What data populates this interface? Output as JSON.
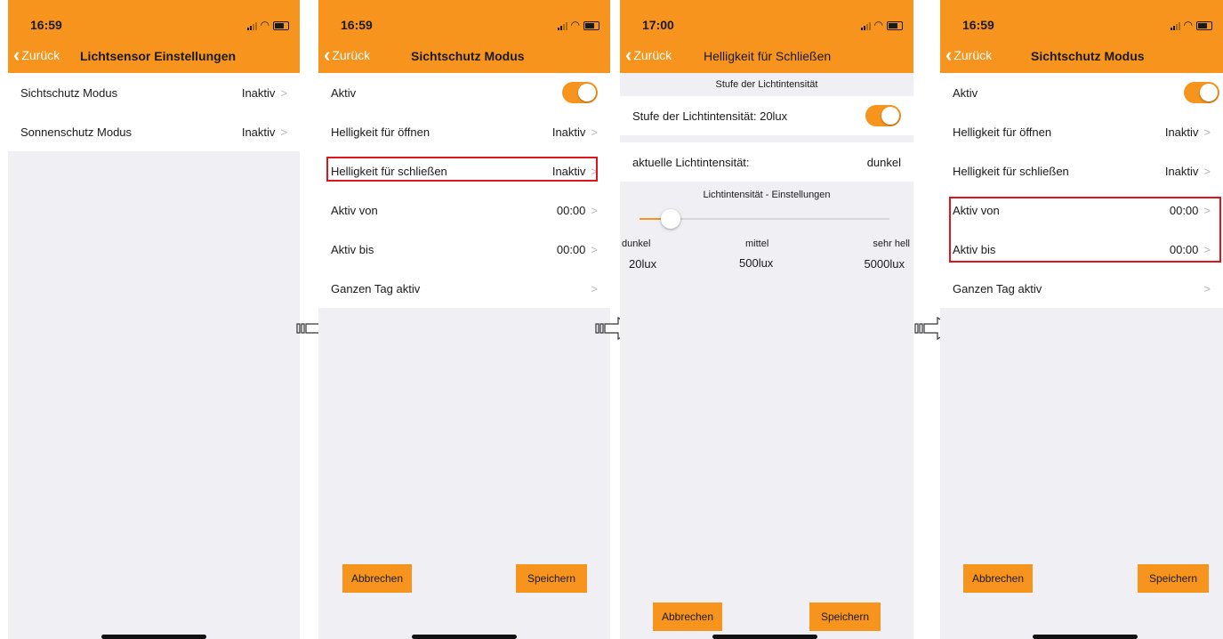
{
  "screen1": {
    "time": "16:59",
    "back_label": "Zurück",
    "title": "Lichtsensor Einstellungen",
    "rows": [
      {
        "label": "Sichtschutz Modus",
        "value": "Inaktiv"
      },
      {
        "label": "Sonnenschutz Modus",
        "value": "Inaktiv"
      }
    ]
  },
  "screen2": {
    "time": "16:59",
    "back_label": "Zurück",
    "title": "Sichtschutz Modus",
    "rows": [
      {
        "label": "Aktiv",
        "value": ""
      },
      {
        "label": "Helligkeit für öffnen",
        "value": "Inaktiv"
      },
      {
        "label": "Helligkeit für schließen",
        "value": "Inaktiv"
      },
      {
        "label": "Aktiv von",
        "value": "00:00"
      },
      {
        "label": "Aktiv bis",
        "value": "00:00"
      },
      {
        "label": "Ganzen Tag aktiv",
        "value": ""
      }
    ],
    "cancel_label": "Abbrechen",
    "save_label": "Speichern"
  },
  "screen3": {
    "time": "17:00",
    "back_label": "Zurück",
    "title": "Helligkeit für Schließen",
    "section1_header": "Stufe der Lichtintensität",
    "level_row": "Stufe der Lichtintensität: 20lux",
    "current_label": "aktuelle Lichtintensität:",
    "current_value": "dunkel",
    "section2_header": "Lichtintensität - Einstellungen",
    "levels": [
      "dunkel",
      "mittel",
      "sehr hell"
    ],
    "lux": [
      "20lux",
      "500lux",
      "5000lux"
    ],
    "cancel_label": "Abbrechen",
    "save_label": "Speichern"
  },
  "screen4": {
    "time": "16:59",
    "back_label": "Zurück",
    "title": "Sichtschutz Modus",
    "rows": [
      {
        "label": "Aktiv",
        "value": ""
      },
      {
        "label": "Helligkeit für öffnen",
        "value": "Inaktiv"
      },
      {
        "label": "Helligkeit für schließen",
        "value": "Inaktiv"
      },
      {
        "label": "Aktiv von",
        "value": "00:00"
      },
      {
        "label": "Aktiv bis",
        "value": "00:00"
      },
      {
        "label": "Ganzen Tag aktiv",
        "value": ""
      }
    ],
    "cancel_label": "Abbrechen",
    "save_label": "Speichern"
  },
  "colors": {
    "accent": "#f7941d",
    "highlight": "#e0151b",
    "background": "#efeff4"
  },
  "icons": [
    "back-chevron-icon",
    "signal-icon",
    "wifi-icon",
    "battery-icon",
    "chevron-right-icon",
    "toggle-switch",
    "next-step-arrow-icon"
  ]
}
